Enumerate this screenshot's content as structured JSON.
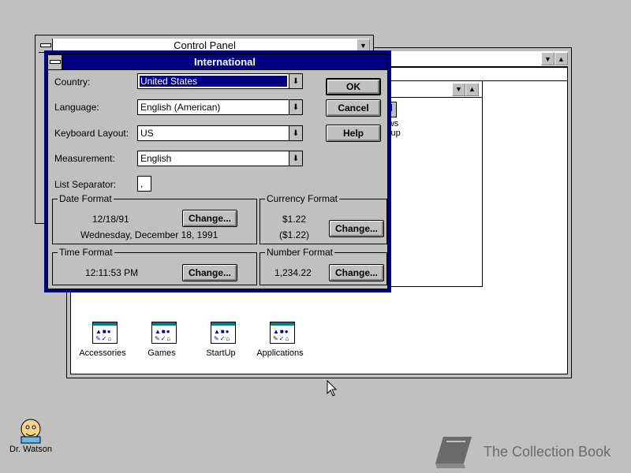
{
  "control_panel": {
    "title": "Control Panel"
  },
  "program_manager": {
    "groups": [
      {
        "label": "Accessories"
      },
      {
        "label": "Games"
      },
      {
        "label": "StartUp"
      },
      {
        "label": "Applications"
      }
    ],
    "windows_setup_label_line1": "indows",
    "windows_setup_label_line2": "Setup"
  },
  "dialog": {
    "title": "International",
    "fields": {
      "country": {
        "label": "Country:",
        "value": "United States"
      },
      "language": {
        "label": "Language:",
        "value": "English (American)"
      },
      "keyboard": {
        "label": "Keyboard Layout:",
        "value": "US"
      },
      "measurement": {
        "label": "Measurement:",
        "value": "English"
      },
      "list_separator": {
        "label": "List Separator:",
        "value": ","
      }
    },
    "buttons": {
      "ok": "OK",
      "cancel": "Cancel",
      "help": "Help"
    },
    "date_format": {
      "title": "Date Format",
      "short": "12/18/91",
      "long": "Wednesday, December 18, 1991",
      "change": "Change..."
    },
    "currency_format": {
      "title": "Currency Format",
      "positive": "$1.22",
      "negative": "($1.22)",
      "change": "Change..."
    },
    "time_format": {
      "title": "Time Format",
      "value": "12:11:53 PM",
      "change": "Change..."
    },
    "number_format": {
      "title": "Number Format",
      "value": "1,234.22",
      "change": "Change..."
    }
  },
  "desktop": {
    "dr_watson_label": "Dr. Watson",
    "watermark": "The Collection Book"
  }
}
